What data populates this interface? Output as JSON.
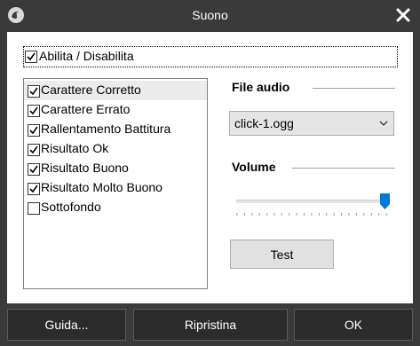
{
  "window": {
    "title": "Suono"
  },
  "enable": {
    "label": "Abilita / Disabilita",
    "checked": true
  },
  "events": [
    {
      "label": "Carattere Corretto",
      "checked": true,
      "selected": true
    },
    {
      "label": "Carattere Errato",
      "checked": true,
      "selected": false
    },
    {
      "label": "Rallentamento Battitura",
      "checked": true,
      "selected": false
    },
    {
      "label": "Risultato Ok",
      "checked": true,
      "selected": false
    },
    {
      "label": "Risultato Buono",
      "checked": true,
      "selected": false
    },
    {
      "label": "Risultato Molto Buono",
      "checked": true,
      "selected": false
    },
    {
      "label": "Sottofondo",
      "checked": false,
      "selected": false
    }
  ],
  "audio": {
    "heading": "File audio",
    "selected_file": "click-1.ogg"
  },
  "volume": {
    "heading": "Volume",
    "level_fraction": 0.985
  },
  "test_button": "Test",
  "footer": {
    "help": "Guida...",
    "reset": "Ripristina",
    "ok": "OK"
  },
  "colors": {
    "accent": "#0078d7",
    "titlebar": "#3a3a3a",
    "footer_button": "#2b2b2b"
  },
  "icons": {
    "app": "app-logo-icon",
    "close": "close-icon",
    "dropdown": "chevron-down-icon",
    "check": "checkmark-icon"
  }
}
